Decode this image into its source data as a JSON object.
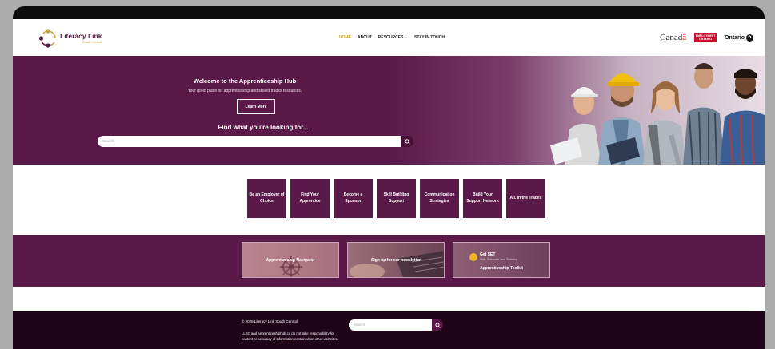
{
  "header": {
    "logo_name": "Literacy Link",
    "logo_sub": "South Central",
    "nav": [
      {
        "label": "HOME",
        "active": true
      },
      {
        "label": "ABOUT"
      },
      {
        "label": "RESOURCES ⌄"
      },
      {
        "label": "STAY IN TOUCH"
      }
    ],
    "partners": {
      "canada_prefix": "Canad",
      "canada_suffix": "ä",
      "employment_line1": "EMPLOYMENT",
      "employment_line2": "ONTARIO",
      "ontario": "Ontario"
    }
  },
  "hero": {
    "title": "Welcome to the Apprenticeship Hub",
    "subtitle": "Your go-to place for apprenticeship and skilled trades resources.",
    "button_label": "Learn More",
    "find_title": "Find what you're looking for...",
    "search_placeholder": "Search"
  },
  "cards": [
    "Be an Employer of Choice",
    "Find Your Apprentice",
    "Become a Sponsor",
    "Skill Building Support",
    "Communication Strategies",
    "Build Your Support Network",
    "A.I. in the Trades"
  ],
  "promos": {
    "navigator": "Apprenticeship Navigator",
    "newsletter": "Sign up for our newsletter",
    "getset_title": "Get SET",
    "getset_tagline": "Skill, Educate and Training",
    "toolkit": "Apprenticeship Toolkit"
  },
  "footer": {
    "copyright": "© 2026 Literacy Link South Central",
    "disclaimer": "LLSC and apprenticeshiphub.ca do not take responsibility for content or accuracy of information contained on other websites.",
    "search_placeholder": "Search"
  },
  "colors": {
    "brand_plum": "#5b1949",
    "accent_gold": "#c9a23a",
    "footer_dark": "#200417"
  }
}
